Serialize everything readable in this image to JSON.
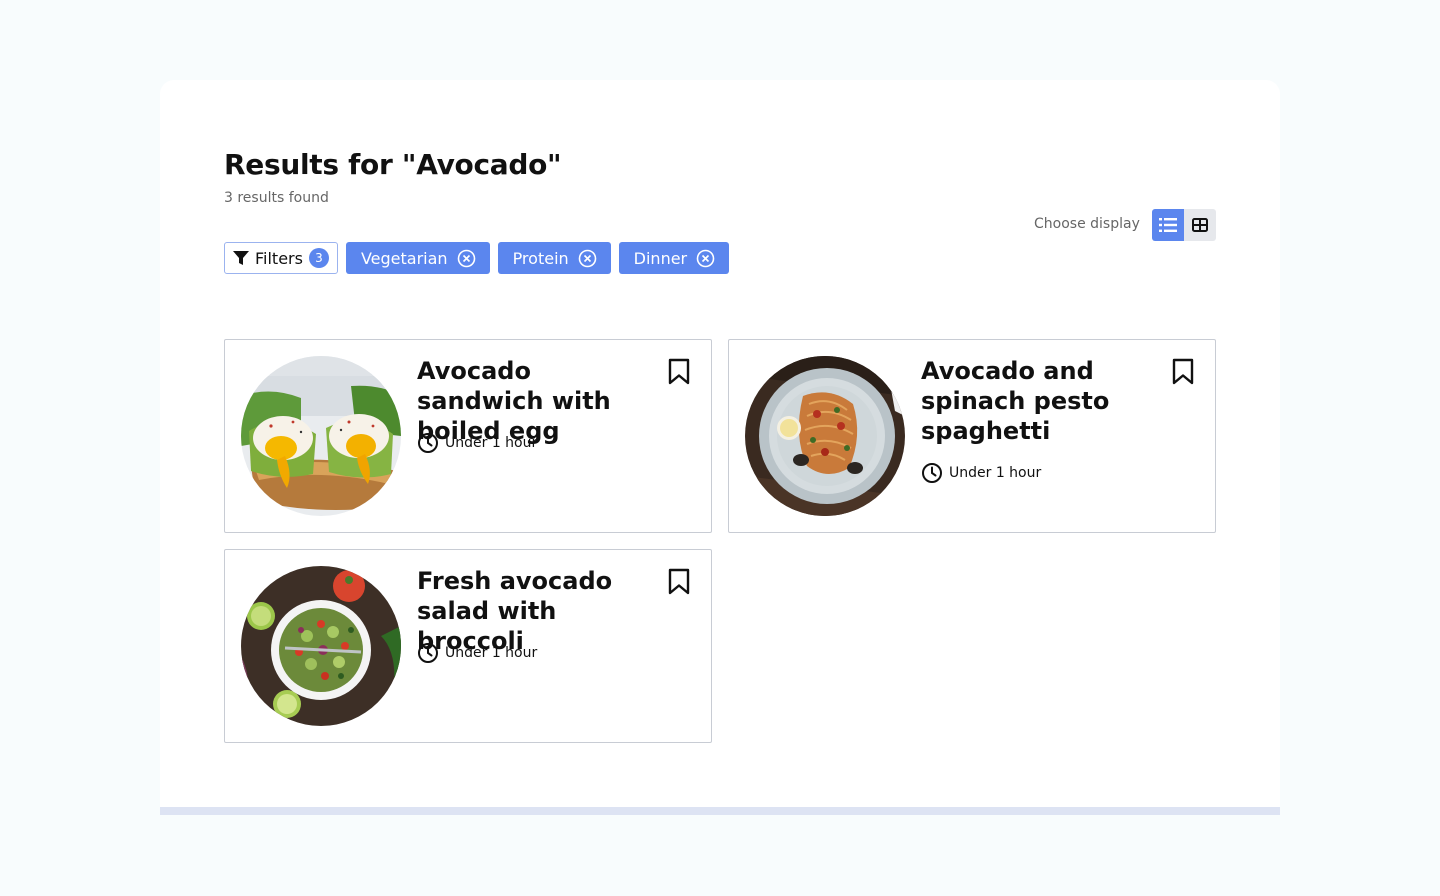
{
  "header": {
    "title": "Results for \"Avocado\"",
    "results_count": "3 results found"
  },
  "display": {
    "label": "Choose display",
    "options": [
      "list",
      "grid"
    ],
    "selected": "list",
    "accent_color": "#5b86ee"
  },
  "filters": {
    "button_label": "Filters",
    "count": "3",
    "active": [
      {
        "label": "Vegetarian"
      },
      {
        "label": "Protein"
      },
      {
        "label": "Dinner"
      }
    ]
  },
  "recipes": [
    {
      "title": "Avocado sandwich with boiled egg",
      "time": "Under 1 hour",
      "image": "avocado-toast-egg"
    },
    {
      "title": "Avocado and spinach pesto spaghetti",
      "time": "Under 1 hour",
      "image": "pesto-spaghetti-plate"
    },
    {
      "title": "Fresh avocado salad with broccoli",
      "time": "Under 1 hour",
      "image": "avocado-salad-bowl"
    }
  ]
}
